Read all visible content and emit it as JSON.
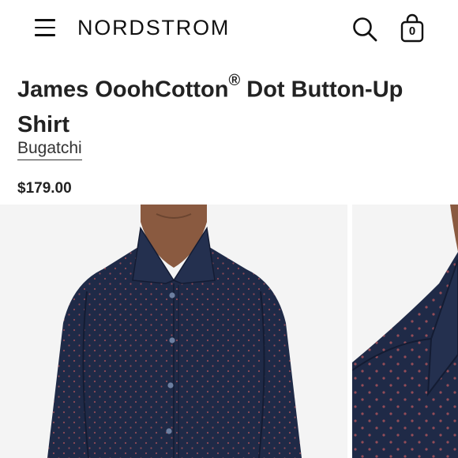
{
  "header": {
    "logo": "NORDSTROM",
    "menu_icon": "hamburger-menu-icon",
    "search_icon": "search-icon",
    "bag_icon": "shopping-bag-icon",
    "bag_count": "0"
  },
  "product": {
    "title_main": "James OoohCotton",
    "title_mark": "®",
    "title_rest": " Dot Button-Up Shirt",
    "brand": "Bugatchi",
    "price": "$179.00"
  },
  "gallery": {
    "shirt_color": "#1f2a47",
    "dot_color": "#a8525a",
    "background_color": "#f4f4f4"
  }
}
